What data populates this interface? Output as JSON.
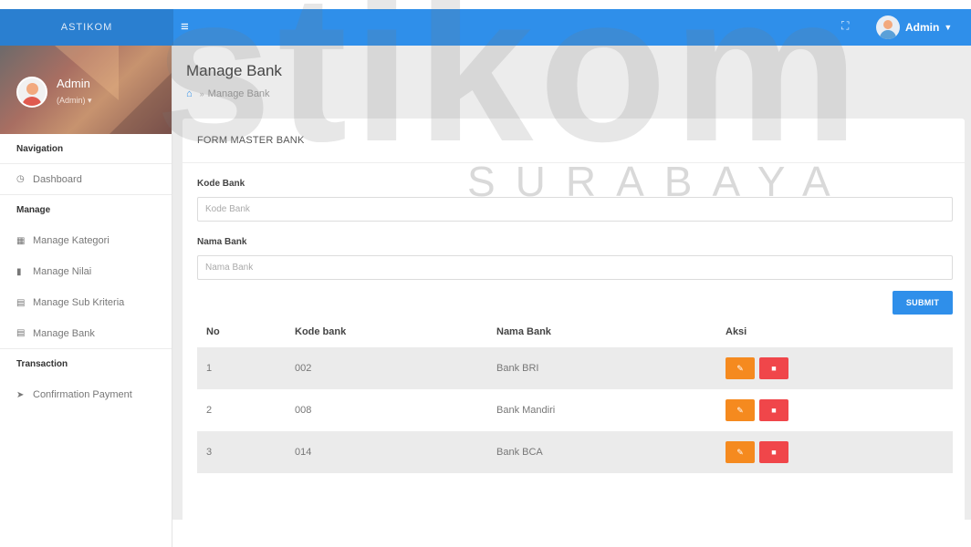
{
  "topbar": {
    "brand": "ASTIKOM",
    "menu_icon": "hamburger-icon",
    "fullscreen_icon": "expand-icon",
    "user_name": "Admin",
    "caret": "⌄",
    "accent": "#2f8fea"
  },
  "sidebar": {
    "profile": {
      "name": "Admin",
      "role": "(Admin)",
      "caret": "▾"
    },
    "sections": [
      {
        "header": "Navigation",
        "items": [
          {
            "label": "Dashboard",
            "icon": "dashboard-icon"
          }
        ]
      },
      {
        "header": "Manage",
        "items": [
          {
            "label": "Manage Kategori",
            "icon": "table-icon"
          },
          {
            "label": "Manage Nilai",
            "icon": "book-icon"
          },
          {
            "label": "Manage Sub Kriteria",
            "icon": "card-icon"
          },
          {
            "label": "Manage Bank",
            "icon": "card-icon"
          }
        ]
      },
      {
        "header": "Transaction",
        "items": [
          {
            "label": "Confirmation Payment",
            "icon": "send-icon"
          }
        ]
      }
    ]
  },
  "main": {
    "title": "Manage Bank",
    "breadcrumb": {
      "home_icon": "home-icon",
      "separator": "»",
      "current": "Manage Bank"
    },
    "panel": {
      "heading": "FORM MASTER BANK",
      "fields": {
        "kode": {
          "label": "Kode Bank",
          "placeholder": "Kode Bank",
          "value": ""
        },
        "nama": {
          "label": "Nama Bank",
          "placeholder": "Nama Bank",
          "value": ""
        }
      },
      "submit_label": "SUBMIT",
      "table": {
        "headers": [
          "No",
          "Kode bank",
          "Nama Bank",
          "Aksi"
        ],
        "rows": [
          {
            "no": "1",
            "kode": "002",
            "nama": "Bank BRI"
          },
          {
            "no": "2",
            "kode": "008",
            "nama": "Bank Mandiri"
          },
          {
            "no": "3",
            "kode": "014",
            "nama": "Bank BCA"
          }
        ],
        "edit_icon": "edit-icon",
        "delete_icon": "trash-icon",
        "edit_color": "#f58a1f",
        "delete_color": "#f0464a"
      }
    }
  },
  "watermark": {
    "main": "stikom",
    "sub": "SURABAYA"
  }
}
